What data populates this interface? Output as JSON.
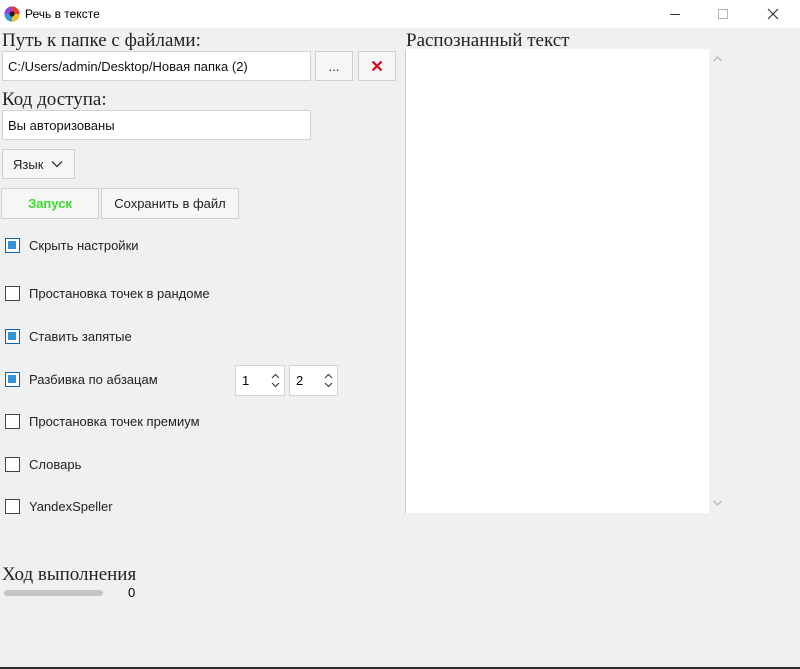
{
  "window": {
    "title": "Речь в тексте",
    "minimize_icon": "minimize-icon",
    "maximize_icon": "maximize-icon",
    "close_icon": "close-icon"
  },
  "folder": {
    "label": "Путь к папке с файлами:",
    "value": "C:/Users/admin/Desktop/Новая папка (2)",
    "browse_label": "...",
    "clear_icon": "red-x-icon"
  },
  "access": {
    "label": "Код доступа:",
    "value": "Вы авторизованы"
  },
  "language": {
    "label": "Язык",
    "icon": "chevron-down-icon"
  },
  "actions": {
    "start_label": "Запуск",
    "save_label": "Сохранить в файл"
  },
  "options": {
    "hide_settings": {
      "label": "Скрыть настройки",
      "checked": true
    },
    "random_dots": {
      "label": "Простановка точек в рандоме",
      "checked": false
    },
    "commas": {
      "label": "Ставить запятые",
      "checked": true
    },
    "paragraphs": {
      "label": "Разбивка по абзацам",
      "checked": true,
      "spin1": "1",
      "spin2": "2"
    },
    "premium_dots": {
      "label": "Простановка точек премиум",
      "checked": false
    },
    "dictionary": {
      "label": "Словарь",
      "checked": false
    },
    "yandex": {
      "label": "YandexSpeller",
      "checked": false
    }
  },
  "recognized": {
    "label": "Распознанный текст",
    "text": ""
  },
  "progress": {
    "label": "Ход выполнения",
    "value": "0",
    "fraction": 0
  },
  "colors": {
    "start_text": "#3ddc2e",
    "clear_icon": "#e0001a",
    "checkbox_fill": "#2f95d8"
  }
}
